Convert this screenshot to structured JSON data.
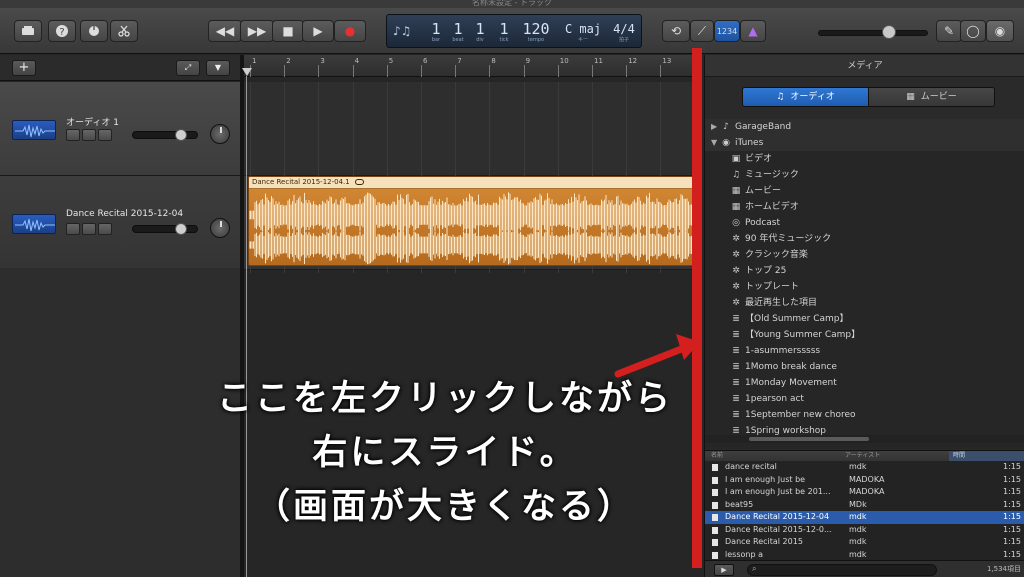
{
  "window": {
    "title": "名称未設定 - トラック"
  },
  "lcd": {
    "bar": "1",
    "beat": "1",
    "div": "1",
    "tick": "1",
    "tempo": "120",
    "key": "C maj",
    "time_sig": "4/4",
    "labels": {
      "bar": "bar",
      "beat": "beat",
      "div": "div",
      "tick": "tick",
      "tempo": "tempo",
      "key": "キー",
      "sig": "拍子"
    },
    "count_in": "1234"
  },
  "tracks": [
    {
      "name": "オーディオ 1",
      "selected": false
    },
    {
      "name": "Dance Recital 2015-12-04",
      "selected": true
    }
  ],
  "ruler": {
    "marks": [
      "1",
      "2",
      "3",
      "4",
      "5",
      "6",
      "7",
      "8",
      "9",
      "10",
      "11",
      "12",
      "13"
    ]
  },
  "region": {
    "title": "Dance Recital 2015-12-04.1"
  },
  "annotation": {
    "line1": "ここを左クリックしながら",
    "line2": "右にスライド。",
    "line3": "（画面が大きくなる）",
    "color": "#d41f1f"
  },
  "media": {
    "title": "メディア",
    "tabs": [
      {
        "label": "オーディオ",
        "active": true
      },
      {
        "label": "ムービー",
        "active": false
      }
    ],
    "tree": [
      {
        "label": "GarageBand",
        "level": 0,
        "expanded": false,
        "icon": "guitar-icon"
      },
      {
        "label": "iTunes",
        "level": 0,
        "expanded": true,
        "icon": "itunes-icon"
      },
      {
        "label": "ビデオ",
        "level": 1,
        "icon": "video-icon"
      },
      {
        "label": "ミュージック",
        "level": 1,
        "icon": "music-note-icon"
      },
      {
        "label": "ムービー",
        "level": 1,
        "icon": "film-icon"
      },
      {
        "label": "ホームビデオ",
        "level": 1,
        "icon": "film-icon"
      },
      {
        "label": "Podcast",
        "level": 1,
        "icon": "podcast-icon"
      },
      {
        "label": "90 年代ミュージック",
        "level": 1,
        "icon": "gear-icon"
      },
      {
        "label": "クラシック音楽",
        "level": 1,
        "icon": "gear-icon"
      },
      {
        "label": "トップ 25",
        "level": 1,
        "icon": "gear-icon"
      },
      {
        "label": "トップレート",
        "level": 1,
        "icon": "gear-icon"
      },
      {
        "label": "最近再生した項目",
        "level": 1,
        "icon": "gear-icon"
      },
      {
        "label": "【Old Summer Camp】",
        "level": 1,
        "icon": "playlist-icon"
      },
      {
        "label": "【Young Summer Camp】",
        "level": 1,
        "icon": "playlist-icon"
      },
      {
        "label": "1-asummersssss",
        "level": 1,
        "icon": "playlist-icon"
      },
      {
        "label": "1Momo break dance",
        "level": 1,
        "icon": "playlist-icon"
      },
      {
        "label": "1Monday Movement",
        "level": 1,
        "icon": "playlist-icon"
      },
      {
        "label": "1pearson act",
        "level": 1,
        "icon": "playlist-icon"
      },
      {
        "label": "1September new choreo",
        "level": 1,
        "icon": "playlist-icon"
      },
      {
        "label": "1Spring workshop",
        "level": 1,
        "icon": "playlist-icon"
      }
    ],
    "columns": {
      "name": "名前",
      "artist": "アーティスト",
      "time": "時間"
    },
    "rows": [
      {
        "name": "dance recital",
        "artist": "mdk",
        "time": "1:15",
        "selected": false
      },
      {
        "name": "I am enough Just be",
        "artist": "MADOKA",
        "time": "1:15",
        "selected": false
      },
      {
        "name": "I am enough Just be 201...",
        "artist": "MADOKA",
        "time": "1:15",
        "selected": false
      },
      {
        "name": "beat95",
        "artist": "MDk",
        "time": "1:15",
        "selected": false
      },
      {
        "name": "Dance Recital 2015-12-04",
        "artist": "mdk",
        "time": "1:15",
        "selected": true
      },
      {
        "name": "Dance Recital 2015-12-0...",
        "artist": "mdk",
        "time": "1:15",
        "selected": false
      },
      {
        "name": "Dance Recital 2015",
        "artist": "mdk",
        "time": "1:15",
        "selected": false
      },
      {
        "name": "lessonp a",
        "artist": "mdk",
        "time": "1:15",
        "selected": false
      }
    ],
    "count": "1,534項目",
    "search_placeholder": ""
  }
}
